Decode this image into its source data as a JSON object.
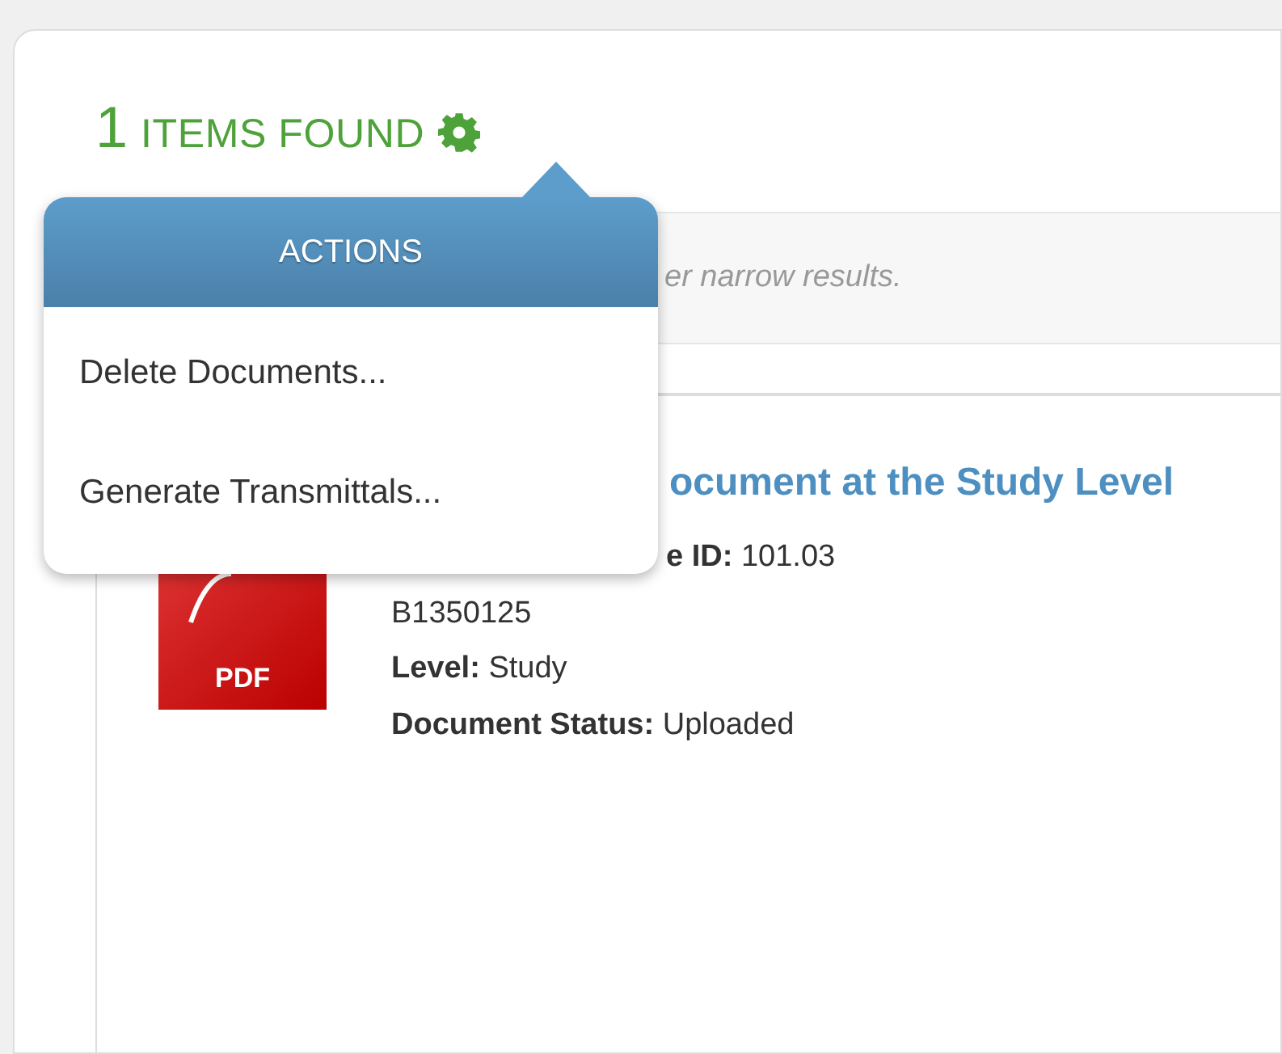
{
  "results_header": {
    "count": "1",
    "label": "ITEMS FOUND"
  },
  "filter_hint": "er narrow results.",
  "results": [
    {
      "title": "ocument at the Study Level",
      "file_type": "PDF",
      "fields": [
        {
          "label": "e ID:",
          "value": "101.03"
        },
        {
          "value": "B1350125"
        },
        {
          "label": "Level:",
          "value": "Study"
        },
        {
          "label": "Document Status:",
          "value": "Uploaded"
        }
      ]
    }
  ],
  "actions_menu": {
    "title": "ACTIONS",
    "items": [
      "Delete Documents...",
      "Generate Transmittals..."
    ]
  }
}
